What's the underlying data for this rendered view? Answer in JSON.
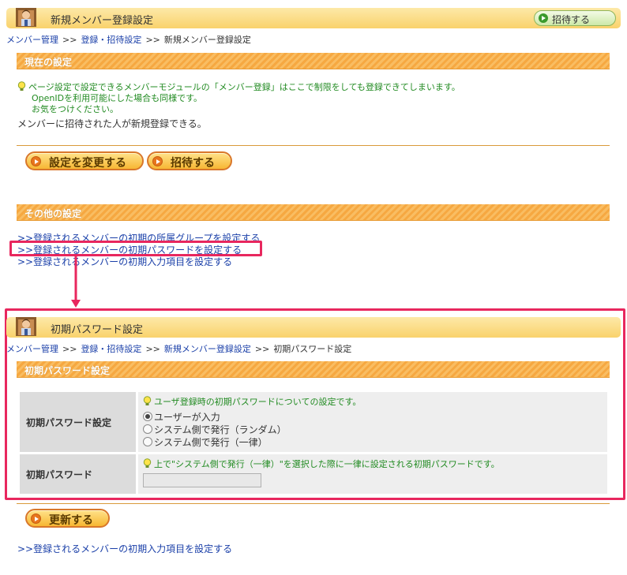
{
  "top_header": {
    "title": "新規メンバー登録設定",
    "invite_button": "招待する"
  },
  "breadcrumb_top": {
    "items": [
      "メンバー管理",
      "登録・招待設定",
      "新規メンバー登録設定"
    ],
    "separator": ">>"
  },
  "current_settings": {
    "heading": "現在の設定",
    "hint_line1": "ページ設定で設定できるメンバーモジュールの「メンバー登録」はここで制限をしても登録できてしまいます。",
    "hint_line2": "OpenIDを利用可能にした場合も同様です。",
    "hint_line3": "お気をつけください。",
    "status_text": "メンバーに招待された人が新規登録できる。",
    "change_button": "設定を変更する",
    "invite_button": "招待する"
  },
  "other_settings": {
    "heading": "その他の設定",
    "links": [
      ">>登録されるメンバーの初期の所属グループを設定する",
      ">>登録されるメンバーの初期パスワードを設定する",
      ">>登録されるメンバーの初期入力項目を設定する"
    ]
  },
  "password_page": {
    "title": "初期パスワード設定",
    "breadcrumb": [
      "メンバー管理",
      "登録・招待設定",
      "新規メンバー登録設定",
      "初期パスワード設定"
    ],
    "section_heading": "初期パスワード設定",
    "row1": {
      "label": "初期パスワード設定",
      "hint": "ユーザ登録時の初期パスワードについての設定です。",
      "options": [
        "ユーザーが入力",
        "システム側で発行（ランダム）",
        "システム側で発行（一律）"
      ],
      "selected": "ユーザーが入力"
    },
    "row2": {
      "label": "初期パスワード",
      "hint": "上で\"システム側で発行（一律）\"を選択した際に一律に設定される初期パスワードです。",
      "value": ""
    },
    "update_button": "更新する"
  },
  "bottom_link": ">>登録されるメンバーの初期入力項目を設定する",
  "colors": {
    "header": "#f9d26c",
    "section": "#f6a841",
    "link": "#1a3fa8",
    "hint": "#228b22",
    "highlight": "#e8275e"
  }
}
